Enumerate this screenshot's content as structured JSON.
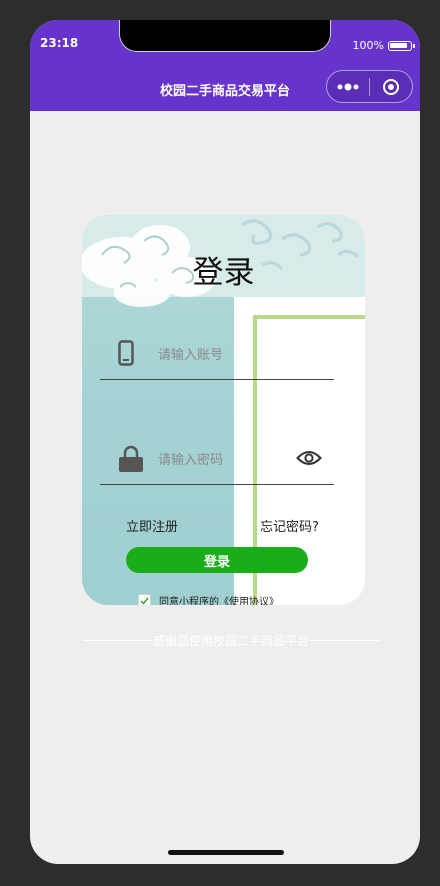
{
  "status_bar": {
    "time": "23:18",
    "battery": "100%"
  },
  "nav": {
    "title": "校园二手商品交易平台"
  },
  "login_card": {
    "title": "登录",
    "account_placeholder": "请输入账号",
    "password_placeholder": "请输入密码",
    "register_label": "立即注册",
    "forgot_label": "忘记密码?",
    "login_label": "登录",
    "agreement_text": "同意小程序的《使用协议》"
  },
  "footer": {
    "text": "感谢您使用校园二手商品平台"
  },
  "colors": {
    "accent": "#6633cc",
    "primary_button": "#1aad19"
  }
}
